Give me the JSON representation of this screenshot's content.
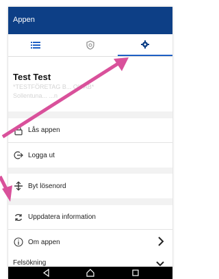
{
  "app": {
    "title": "Appen"
  },
  "tabs": [
    {
      "name": "list",
      "icon": "list-icon"
    },
    {
      "name": "shield",
      "icon": "shield-icon"
    },
    {
      "name": "settings",
      "icon": "gear-icon",
      "active": true
    }
  ],
  "profile": {
    "name": "Test Test",
    "company": "*TESTFÖRETAG B... OK AB*",
    "location": "Sollentuna... ...n"
  },
  "menu": {
    "lock": {
      "label": "Lås appen",
      "icon": "lock-icon"
    },
    "logout": {
      "label": "Logga ut",
      "icon": "logout-icon"
    },
    "change_password": {
      "label": "Byt lösenord",
      "icon": "password-icon"
    },
    "update": {
      "label": "Uppdatera information",
      "icon": "refresh-icon"
    },
    "about": {
      "label": "Om appen",
      "icon": "info-icon"
    },
    "troubleshoot": {
      "label": "Felsökning",
      "icon": "chevron-down-icon"
    }
  },
  "colors": {
    "appbar": "#0d3f86",
    "tab_accent": "#1d5fc4",
    "annotation_arrow": "#d9519b"
  }
}
